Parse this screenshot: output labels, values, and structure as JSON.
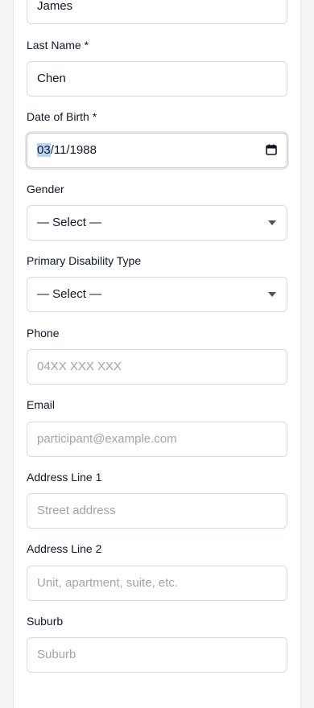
{
  "form": {
    "first_name": {
      "value": "James"
    },
    "last_name": {
      "label": "Last Name *",
      "value": "Chen"
    },
    "dob": {
      "label": "Date of Birth *",
      "day": "03",
      "rest": "/11/1988"
    },
    "gender": {
      "label": "Gender",
      "selected": "— Select —"
    },
    "disability": {
      "label": "Primary Disability Type",
      "selected": "— Select —"
    },
    "phone": {
      "label": "Phone",
      "placeholder": "04XX XXX XXX"
    },
    "email": {
      "label": "Email",
      "placeholder": "participant@example.com"
    },
    "address1": {
      "label": "Address Line 1",
      "placeholder": "Street address"
    },
    "address2": {
      "label": "Address Line 2",
      "placeholder": "Unit, apartment, suite, etc."
    },
    "suburb": {
      "label": "Suburb",
      "placeholder": "Suburb"
    }
  },
  "icons": {
    "select_caret": "chevron-down-icon",
    "date_picker": "calendar-icon"
  },
  "colors": {
    "border": "#d9dce1",
    "placeholder": "#a0a4ab",
    "selection_highlight": "#b9d2f5"
  }
}
